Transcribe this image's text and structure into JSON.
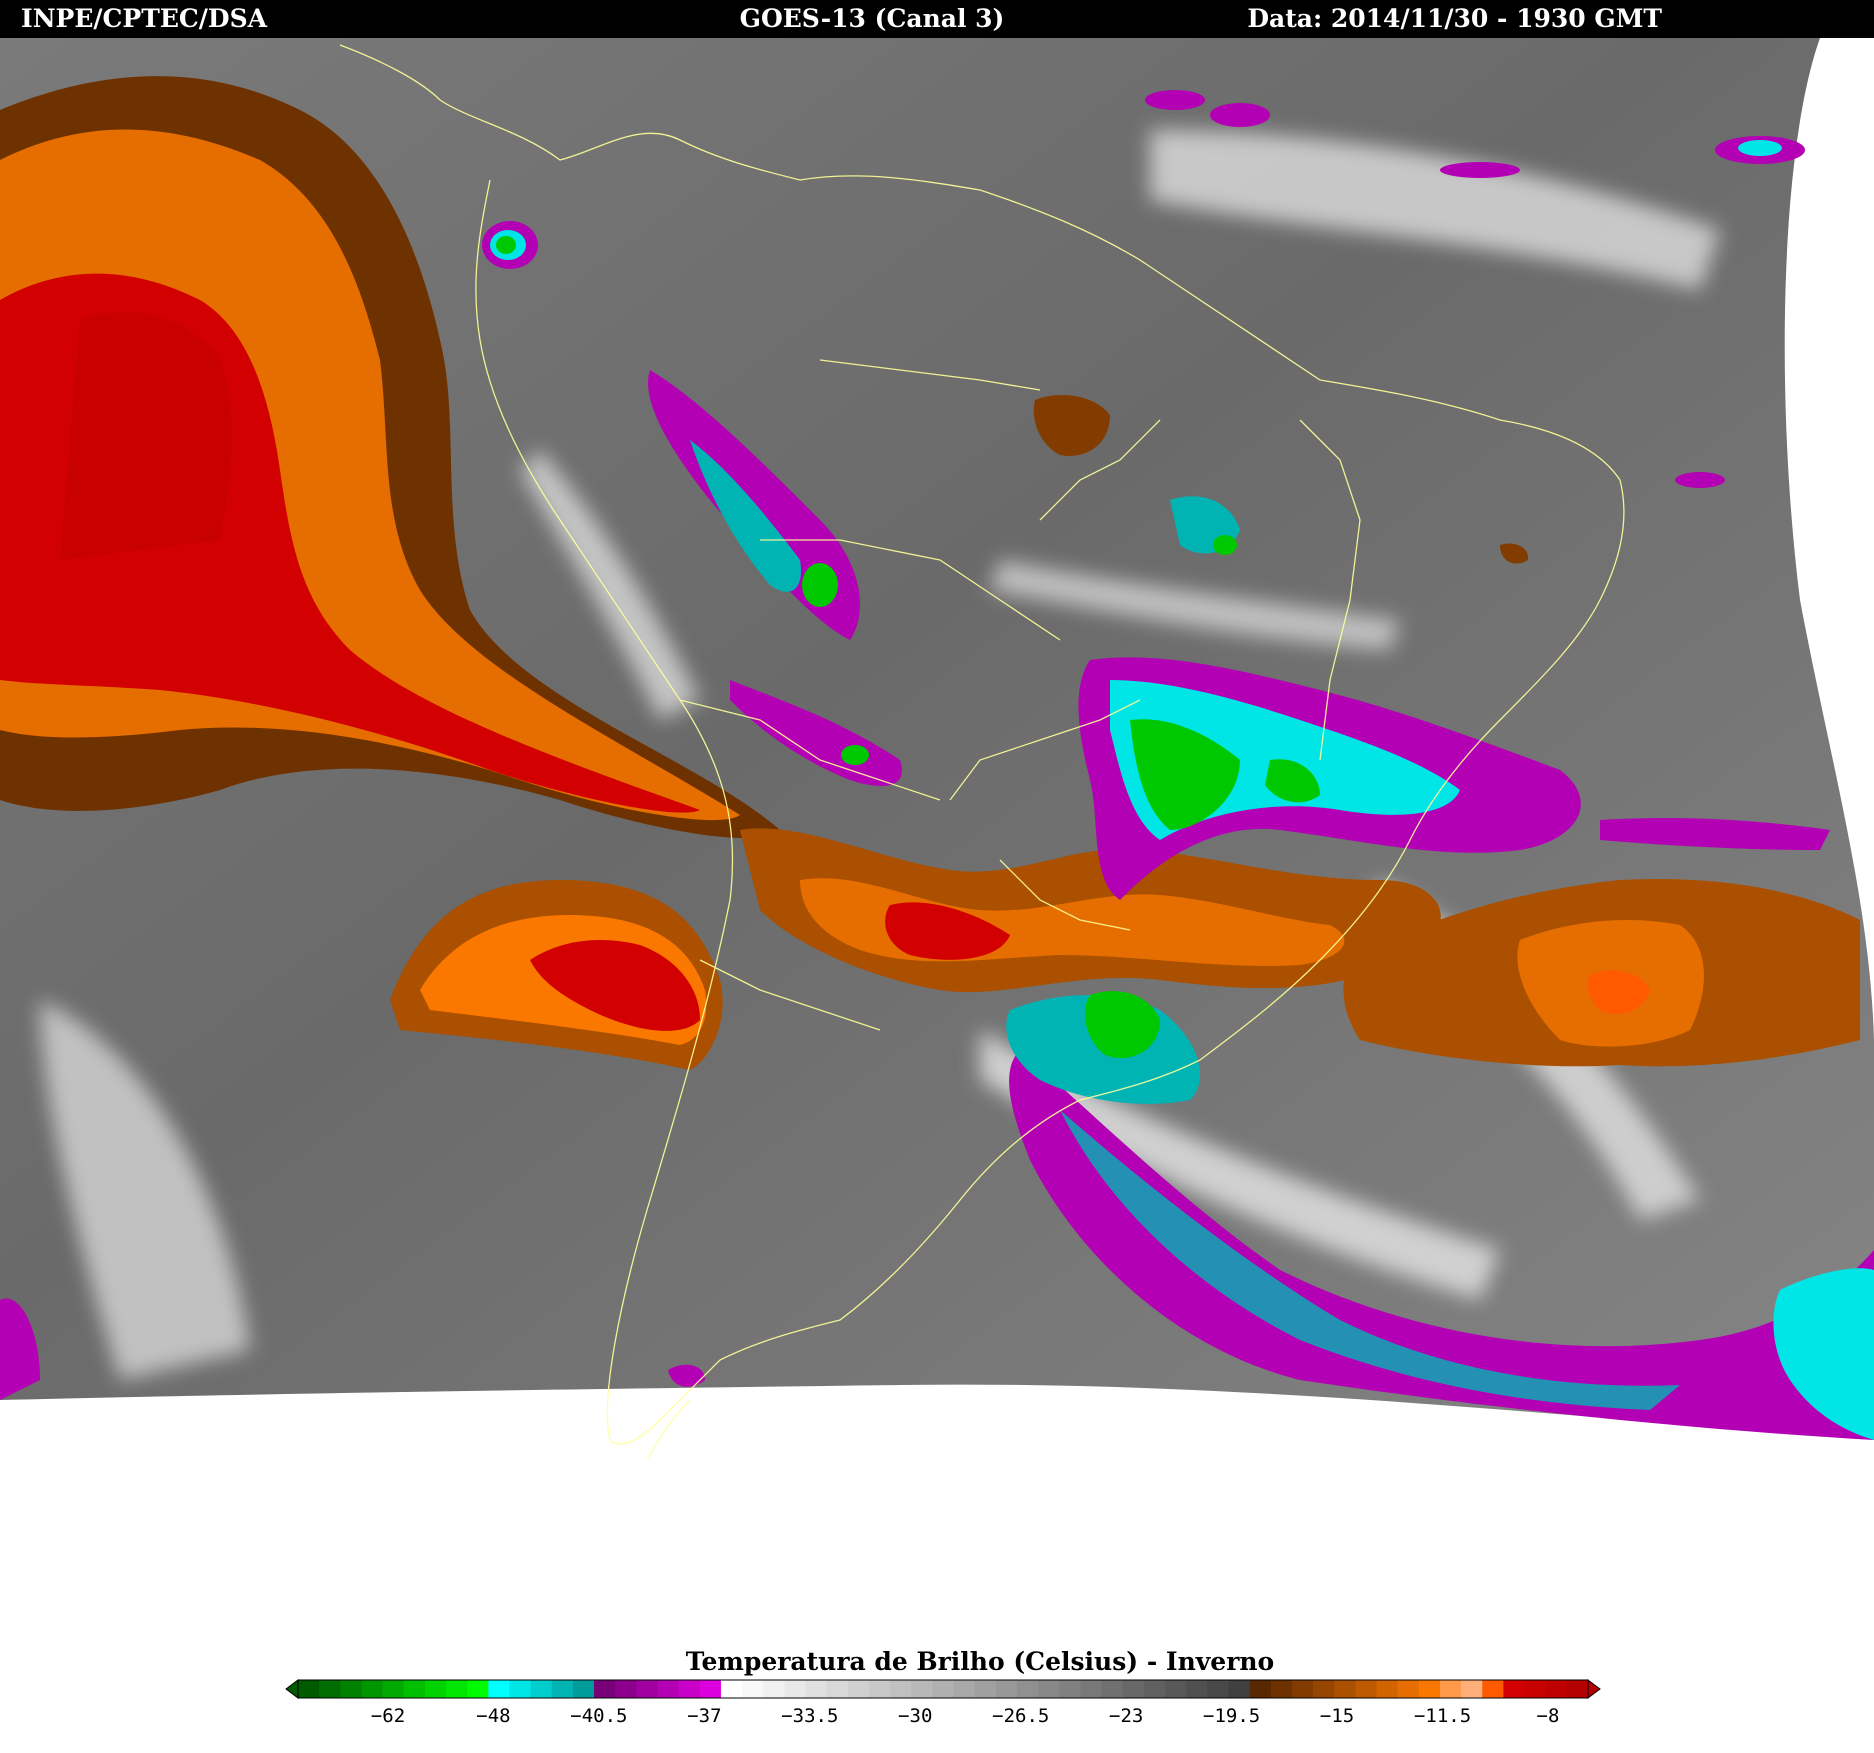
{
  "header": {
    "left": "INPE/CPTEC/DSA",
    "center": "GOES-13 (Canal 3)",
    "right": "Data: 2014/11/30 - 1930 GMT"
  },
  "legend": {
    "title": "Temperatura de Brilho (Celsius) - Inverno",
    "tick_labels": [
      "-62",
      "-48",
      "-40.5",
      "-37",
      "-33.5",
      "-30",
      "-26.5",
      "-23",
      "-19.5",
      "-15",
      "-11.5",
      "-8"
    ],
    "color_steps": [
      "#005a00",
      "#006e00",
      "#008200",
      "#009600",
      "#00aa00",
      "#00be00",
      "#00d200",
      "#00e600",
      "#00fa00",
      "#00ffff",
      "#00e6e6",
      "#00cdcd",
      "#00b4b4",
      "#009b9b",
      "#780078",
      "#8c008c",
      "#a000a0",
      "#b400b4",
      "#c800c8",
      "#dc00dc",
      "#ffffff",
      "#f8f8f8",
      "#f0f0f0",
      "#e8e8e8",
      "#e0e0e0",
      "#d8d8d8",
      "#d0d0d0",
      "#c8c8c8",
      "#c0c0c0",
      "#b8b8b8",
      "#b0b0b0",
      "#a8a8a8",
      "#a0a0a0",
      "#989898",
      "#909090",
      "#888888",
      "#808080",
      "#787878",
      "#707070",
      "#686868",
      "#606060",
      "#585858",
      "#505050",
      "#484848",
      "#404040",
      "#5a2800",
      "#6e3200",
      "#823c00",
      "#964600",
      "#aa5000",
      "#be5a00",
      "#d26400",
      "#e66e00",
      "#fa7800",
      "#ff9a4a",
      "#ffb07a",
      "#ff5a00",
      "#d20000",
      "#c80000",
      "#be0000",
      "#b40000"
    ]
  },
  "palette": {
    "cold_green": "#00c800",
    "cyan": "#00e0e0",
    "magenta": "#b400b4",
    "orange": "#e06e00",
    "red": "#d20000",
    "dark_brown": "#6e3200",
    "coastline": "#ffff99"
  }
}
